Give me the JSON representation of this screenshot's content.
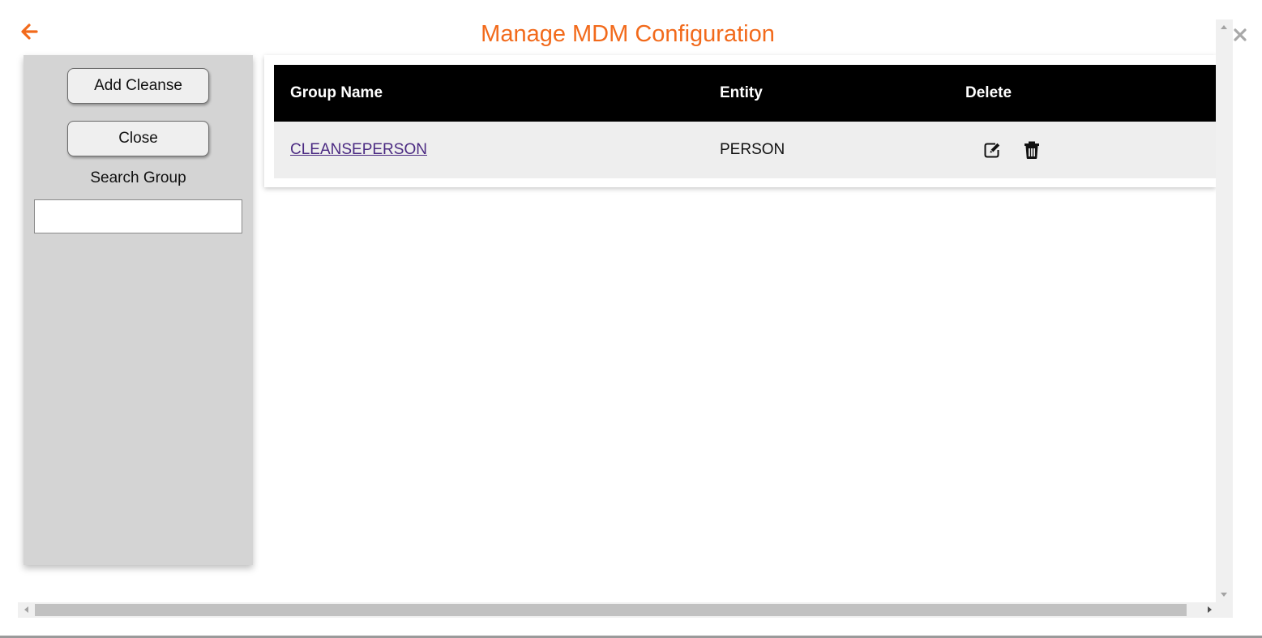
{
  "header": {
    "title": "Manage MDM Configuration",
    "back_icon": "arrow-left-icon",
    "close_icon": "close-x-icon",
    "accent_color": "#f26a1b"
  },
  "sidebar": {
    "add_cleanse_label": "Add Cleanse",
    "close_label": "Close",
    "search_label": "Search Group",
    "search_value": "",
    "search_placeholder": ""
  },
  "table": {
    "columns": [
      "Group Name",
      "Entity",
      "Delete"
    ],
    "rows": [
      {
        "group_name": "CLEANSEPERSON",
        "entity": "PERSON",
        "actions": [
          "edit-icon",
          "trash-icon"
        ]
      }
    ],
    "header_bg": "#000000",
    "row_bg": "#eeeeee",
    "link_color": "#4b2a82"
  }
}
